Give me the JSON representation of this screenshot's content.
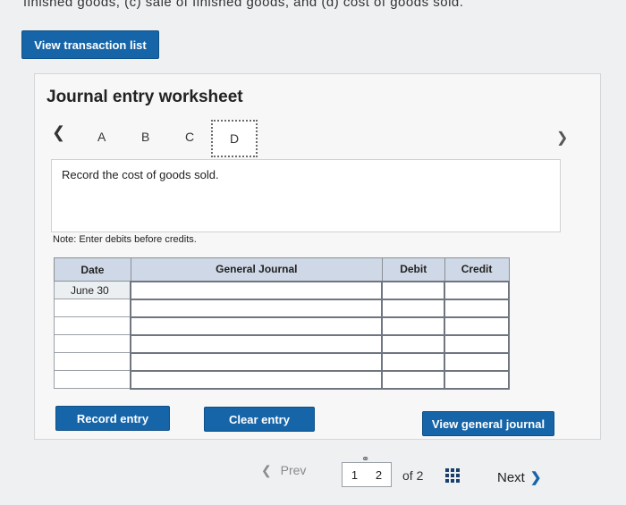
{
  "top_text": "finished goods, (c) sale of finished goods, and (d) cost of goods sold.",
  "view_transaction_label": "View transaction list",
  "worksheet": {
    "title": "Journal entry worksheet",
    "tabs": [
      "A",
      "B",
      "C",
      "D"
    ],
    "active_tab": "D",
    "instruction": "Record the cost of goods sold.",
    "note": "Note: Enter debits before credits."
  },
  "table": {
    "headers": [
      "Date",
      "General Journal",
      "Debit",
      "Credit"
    ],
    "rows": [
      [
        "June 30",
        "",
        "",
        ""
      ],
      [
        "",
        "",
        "",
        ""
      ],
      [
        "",
        "",
        "",
        ""
      ],
      [
        "",
        "",
        "",
        ""
      ],
      [
        "",
        "",
        "",
        ""
      ],
      [
        "",
        "",
        "",
        ""
      ]
    ]
  },
  "buttons": {
    "record_entry": "Record entry",
    "clear_entry": "Clear entry",
    "view_general_journal": "View general journal"
  },
  "pagination": {
    "prev": "Prev",
    "page_1": "1",
    "page_2": "2",
    "of_label": "of 2",
    "next": "Next"
  }
}
